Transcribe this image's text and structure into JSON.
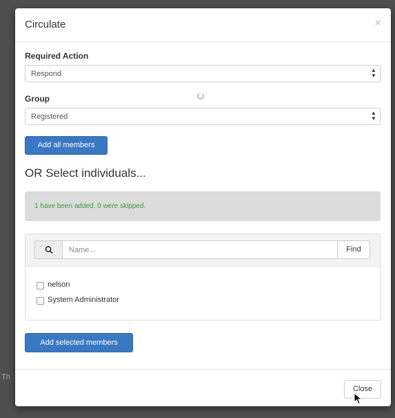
{
  "backdrop": {
    "fragment": "Th"
  },
  "modal": {
    "title": "Circulate",
    "close_glyph": "×"
  },
  "required_action": {
    "label": "Required Action",
    "value": "Respond"
  },
  "group": {
    "label": "Group",
    "value": "Registered"
  },
  "add_all_button": "Add all members",
  "individuals_heading": "OR Select individuals...",
  "alert": {
    "text": "1 have been added. 0 were skipped.",
    "color": "#3c9a3c"
  },
  "search": {
    "icon": "search-icon",
    "placeholder": "Name...",
    "value": "",
    "find_label": "Find"
  },
  "members": [
    {
      "name": "nelson",
      "checked": false
    },
    {
      "name": "System Administrator",
      "checked": false
    }
  ],
  "add_selected_button": "Add selected members",
  "footer": {
    "close_label": "Close"
  },
  "colors": {
    "primary": "#3a78c3",
    "alert_bg": "#dcdcdc"
  }
}
